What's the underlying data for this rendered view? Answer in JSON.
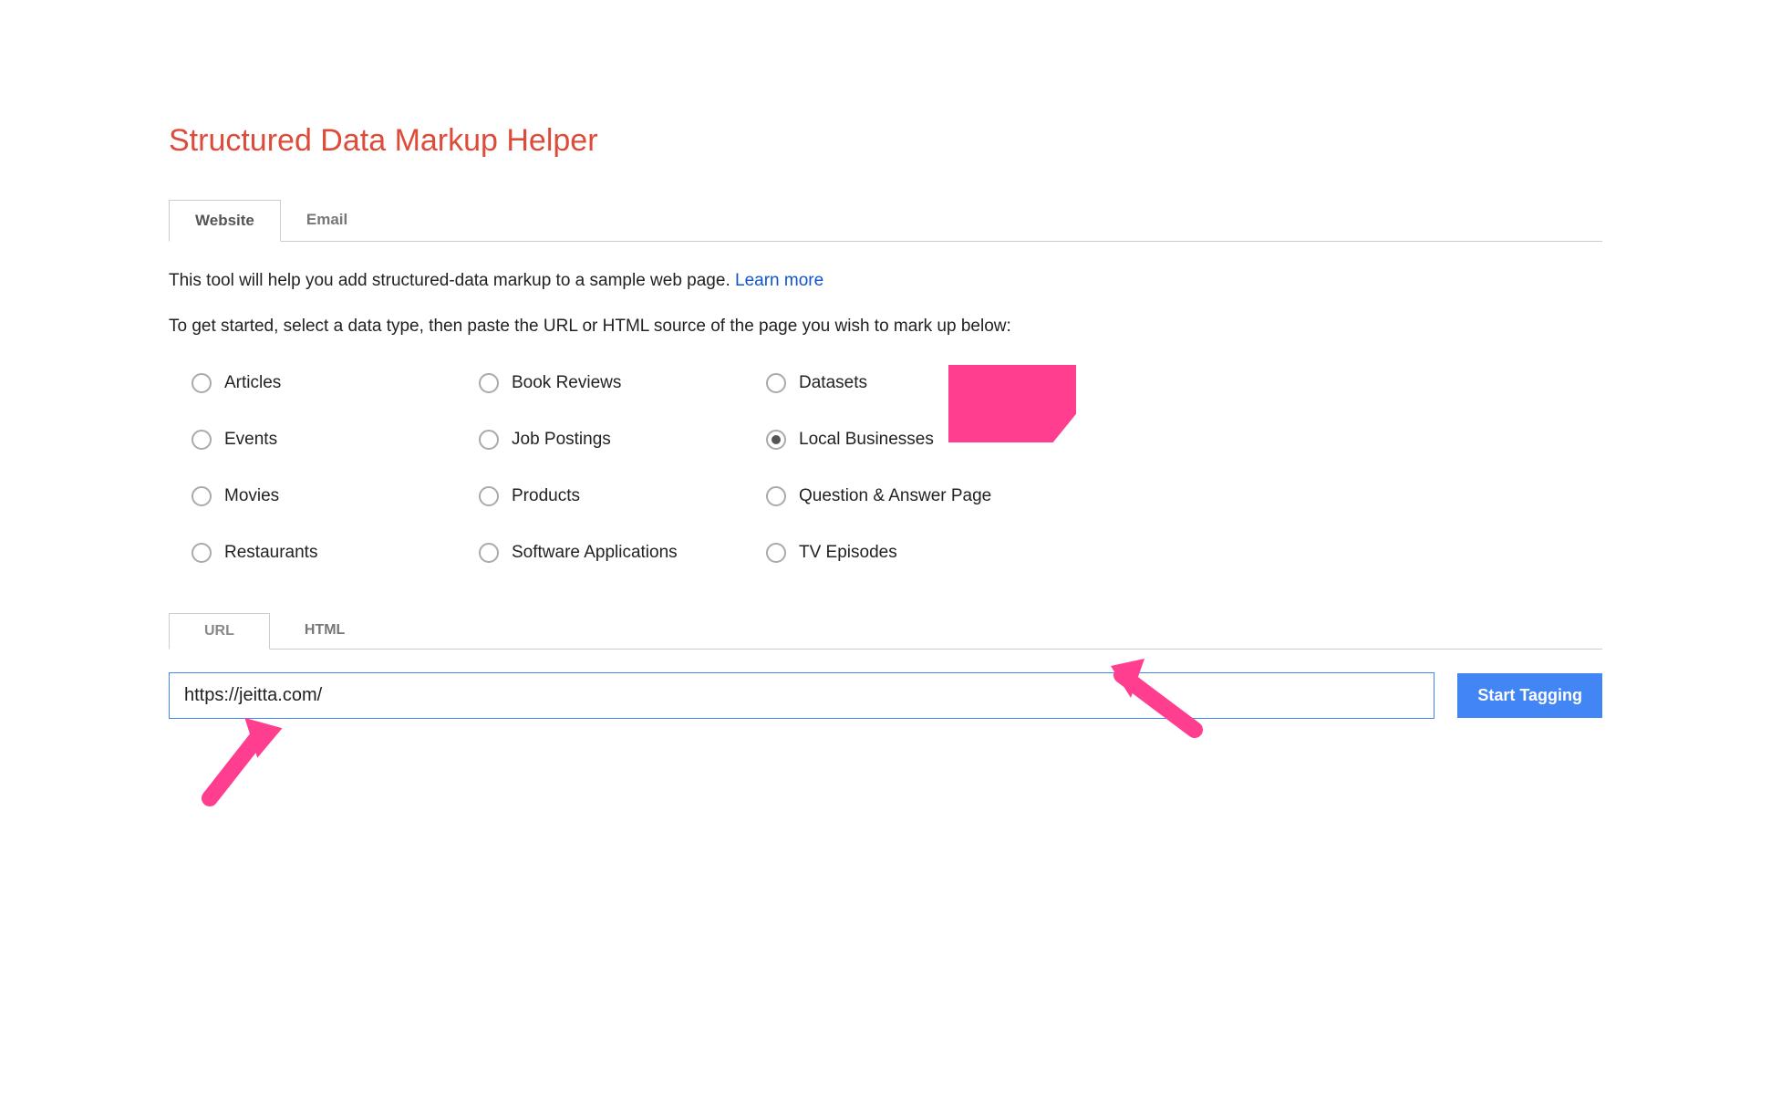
{
  "page_title": "Structured Data Markup Helper",
  "tabs_top": [
    {
      "label": "Website",
      "active": true
    },
    {
      "label": "Email",
      "active": false
    }
  ],
  "description_prefix": "This tool will help you add structured-data markup to a sample web page. ",
  "description_link": "Learn more",
  "instructions": "To get started, select a data type, then paste the URL or HTML source of the page you wish to mark up below:",
  "data_types": [
    {
      "label": "Articles",
      "checked": false
    },
    {
      "label": "Book Reviews",
      "checked": false
    },
    {
      "label": "Datasets",
      "checked": false
    },
    {
      "label": "Events",
      "checked": false
    },
    {
      "label": "Job Postings",
      "checked": false
    },
    {
      "label": "Local Businesses",
      "checked": true
    },
    {
      "label": "Movies",
      "checked": false
    },
    {
      "label": "Products",
      "checked": false
    },
    {
      "label": "Question & Answer Page",
      "checked": false
    },
    {
      "label": "Restaurants",
      "checked": false
    },
    {
      "label": "Software Applications",
      "checked": false
    },
    {
      "label": "TV Episodes",
      "checked": false
    }
  ],
  "tabs_bottom": [
    {
      "label": "URL",
      "active": true
    },
    {
      "label": "HTML",
      "active": false
    }
  ],
  "url_value": "https://jeitta.com/",
  "start_button": "Start Tagging",
  "annotation_arrow_color": "#ff3e8f"
}
